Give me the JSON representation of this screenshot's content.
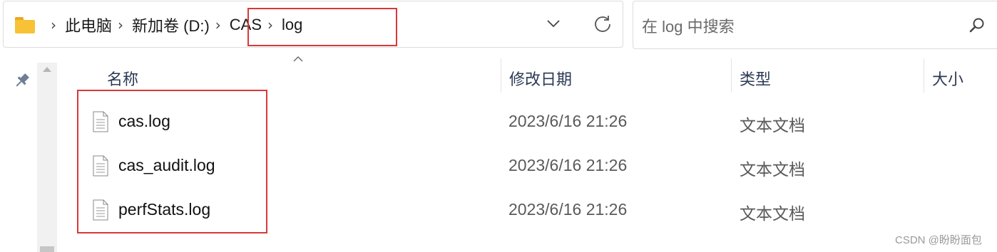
{
  "address_bar": {
    "breadcrumbs": [
      {
        "label": "此电脑"
      },
      {
        "label": "新加卷 (D:)"
      },
      {
        "label": "CAS"
      },
      {
        "label": "log"
      }
    ],
    "icons": {
      "location": "folder-icon",
      "history": "chevron-down-icon",
      "refresh": "refresh-icon"
    }
  },
  "search": {
    "placeholder": "在 log 中搜索",
    "icon": "search-icon"
  },
  "columns": [
    {
      "label": "名称"
    },
    {
      "label": "修改日期"
    },
    {
      "label": "类型"
    },
    {
      "label": "大小"
    }
  ],
  "files": [
    {
      "name": "cas.log",
      "modified": "2023/6/16 21:26",
      "type": "文本文档",
      "size": ""
    },
    {
      "name": "cas_audit.log",
      "modified": "2023/6/16 21:26",
      "type": "文本文档",
      "size": ""
    },
    {
      "name": "perfStats.log",
      "modified": "2023/6/16 21:26",
      "type": "文本文档",
      "size": ""
    }
  ],
  "colors": {
    "highlight": "#d9383a",
    "folder": "#f8c236",
    "header_text": "#2b3a55"
  },
  "watermark": "CSDN @盼盼面包"
}
